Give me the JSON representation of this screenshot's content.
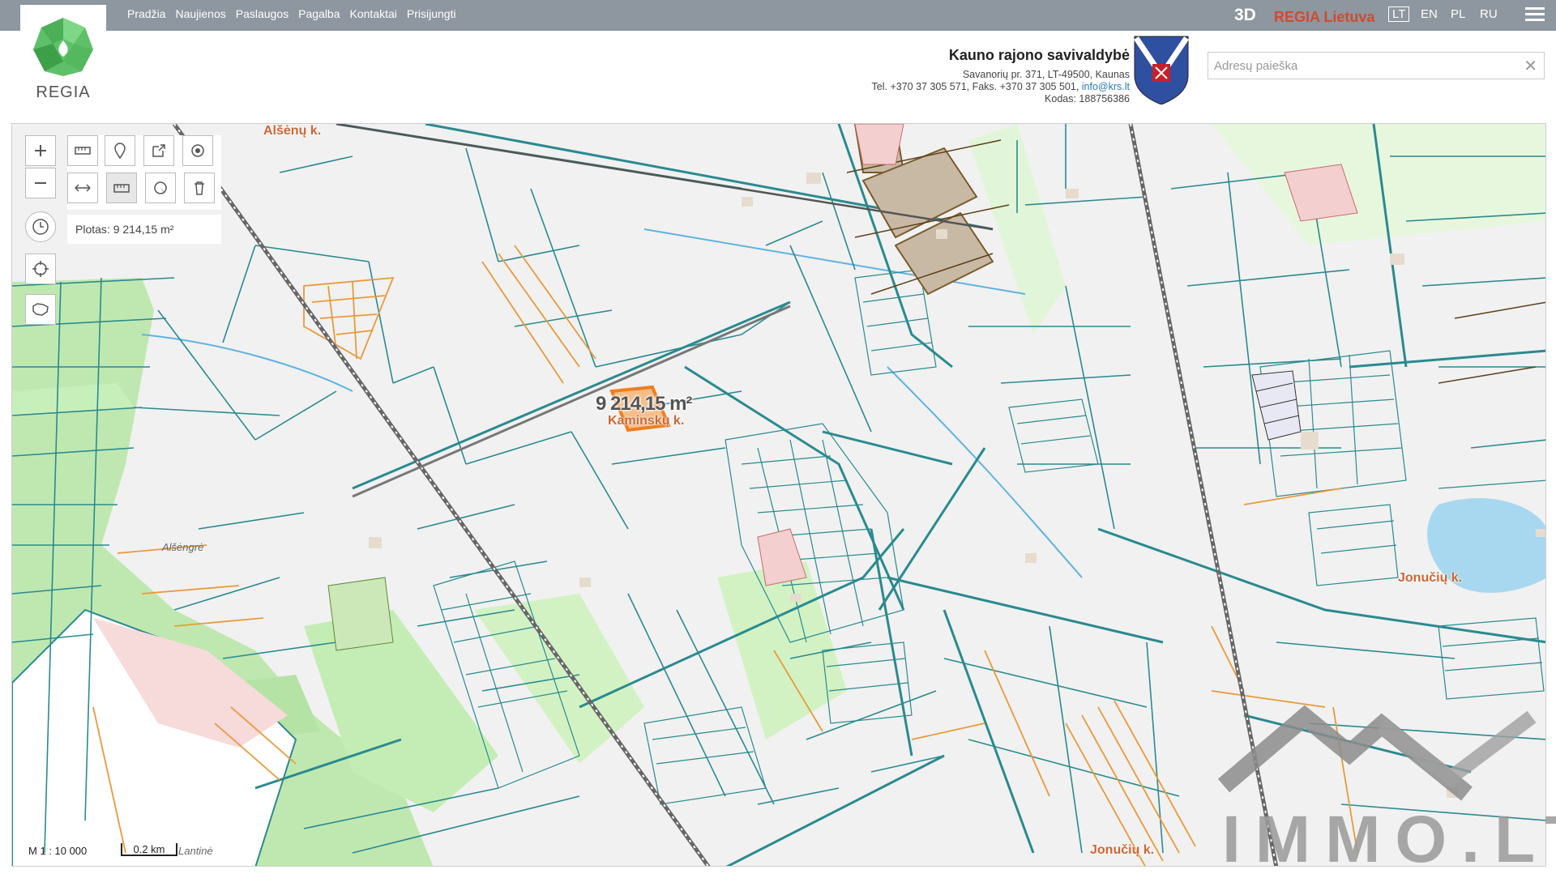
{
  "topnav": {
    "items": [
      "Pradžia",
      "Naujienos",
      "Paslaugos",
      "Pagalba",
      "Kontaktai",
      "Prisijungti"
    ]
  },
  "header": {
    "btn_3d": "3D",
    "regia_lietuva": "REGIA Lietuva",
    "languages": [
      "LT",
      "EN",
      "PL",
      "RU"
    ],
    "active_language": "LT",
    "logo_text": "REGIA",
    "municipality": {
      "title": "Kauno rajono savivaldybė",
      "address": "Savanorių pr. 371, LT-49500, Kaunas",
      "phone_prefix": "Tel. +370 37 305 571, Faks. +370 37 305 501, ",
      "email": "info@krs.lt",
      "code": "Kodas: 188756386"
    },
    "search": {
      "placeholder": "Adresų paieška",
      "value": ""
    }
  },
  "map": {
    "area_panel": "Plotas: 9 214,15 m²",
    "area_label": "9 214,15 m²",
    "scale_ratio": "M 1 : 10 000",
    "scale_bar": "0.2 km",
    "villages": [
      "Alšėnų k.",
      "Kaminskų k.",
      "Jonučių k.",
      "Jonučių k."
    ],
    "places": [
      "Alšėngrė",
      "Lantinė"
    ],
    "colors": {
      "parcel": "#2a8a8f",
      "orange": "#e89a3a",
      "green": "#b9e6a8",
      "railway": "#666666",
      "water": "#a8d8f0"
    }
  },
  "watermark": {
    "text": "IMMO.LT"
  }
}
